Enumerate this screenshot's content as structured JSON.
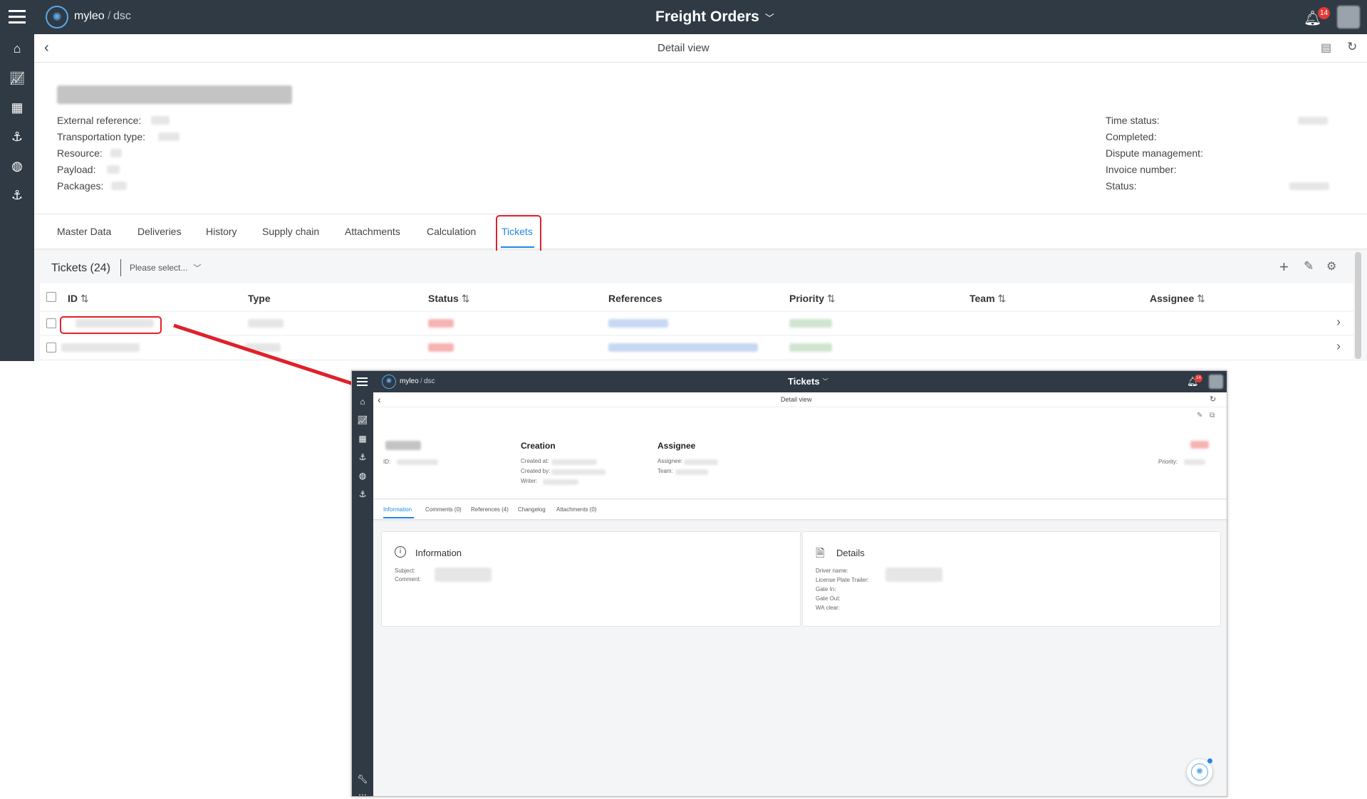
{
  "main": {
    "app_logo_text": "myleo",
    "app_logo_sub": "dsc",
    "page_title": "Freight Orders",
    "notification_count": "14",
    "subheader_title": "Detail view",
    "left_fields": [
      "External reference:",
      "Transportation type:",
      "Resource:",
      "Payload:",
      "Packages:"
    ],
    "right_fields": [
      "Time status:",
      "Completed:",
      "Dispute management:",
      "Invoice number:",
      "Status:"
    ],
    "tabs": [
      "Master Data",
      "Deliveries",
      "History",
      "Supply chain",
      "Attachments",
      "Calculation",
      "Tickets"
    ],
    "active_tab": "Tickets",
    "tickets_title": "Tickets (24)",
    "filter_placeholder": "Please select...",
    "columns": [
      "ID",
      "Type",
      "Status",
      "References",
      "Priority",
      "Team",
      "Assignee"
    ]
  },
  "inset": {
    "app_logo_text": "myleo",
    "app_logo_sub": "dsc",
    "page_title": "Tickets",
    "notification_count": "14",
    "subheader_title": "Detail view",
    "id_label": "ID:",
    "creation_title": "Creation",
    "creation_fields": [
      "Created at:",
      "Created by:",
      "Writer:"
    ],
    "assignee_title": "Assignee",
    "assignee_fields": [
      "Assignee:",
      "Team:"
    ],
    "priority_label": "Priority:",
    "tabs": [
      "Information",
      "Comments (0)",
      "References (4)",
      "Changelog",
      "Attachments (0)"
    ],
    "active_tab": "Information",
    "info_card_title": "Information",
    "info_fields": [
      "Subject:",
      "Comment:"
    ],
    "details_card_title": "Details",
    "details_fields": [
      "Driver name:",
      "License Plate Trailer:",
      "Gate In:",
      "Gate Out:",
      "WA clear:"
    ]
  },
  "colors": {
    "nav_bg": "#2f3a45",
    "accent": "#1e88e5",
    "highlight": "#e0202a",
    "badge": "#e53935"
  }
}
